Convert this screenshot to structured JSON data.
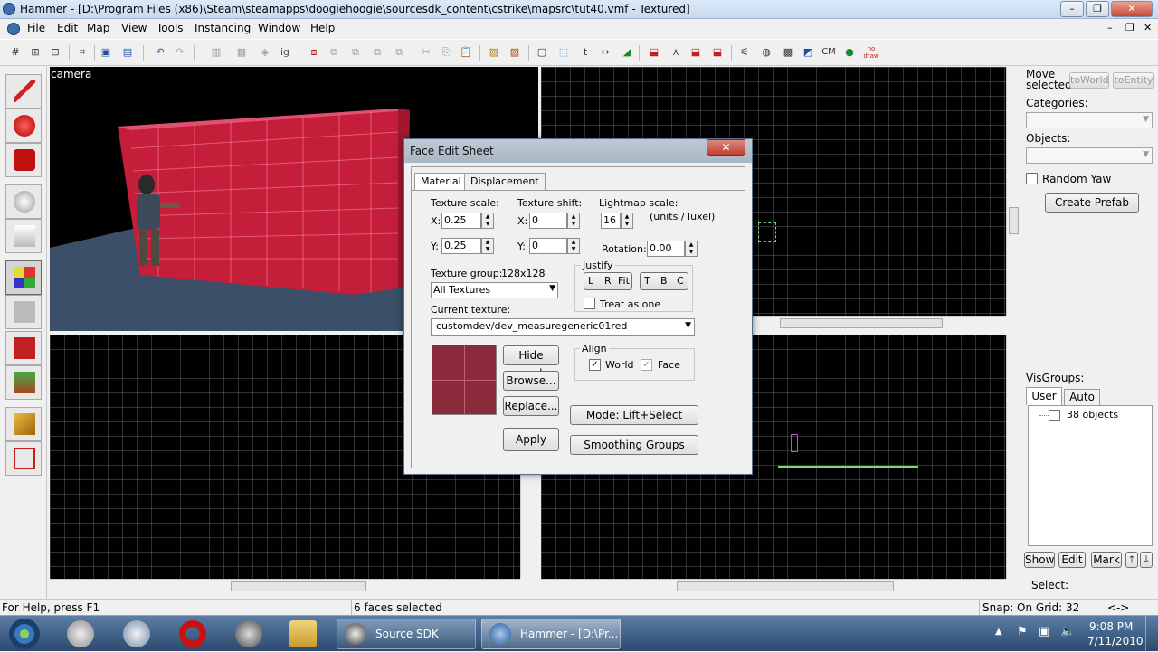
{
  "window": {
    "title": "Hammer - [D:\\Program Files (x86)\\Steam\\steamapps\\doogiehoogie\\sourcesdk_content\\cstrike\\mapsrc\\tut40.vmf - Textured]"
  },
  "menu": [
    "File",
    "Edit",
    "Map",
    "View",
    "Tools",
    "Instancing",
    "Window",
    "Help"
  ],
  "toolbar": {
    "cm_label": "CM",
    "nodraw_label": "no draw"
  },
  "viewports": {
    "camera_label": "camera"
  },
  "face_edit": {
    "title": "Face Edit Sheet",
    "close": "✕",
    "tabs": [
      "Material",
      "Displacement"
    ],
    "texture_scale_label": "Texture scale:",
    "texture_shift_label": "Texture shift:",
    "lightmap_scale_label": "Lightmap scale:",
    "units_label": "(units / luxel)",
    "x_label": "X:",
    "y_label": "Y:",
    "scale_x": "0.25",
    "scale_y": "0.25",
    "shift_x": "0",
    "shift_y": "0",
    "lightmap_scale": "16",
    "rotation_label": "Rotation:",
    "rotation": "0.00",
    "texture_group_label": "Texture group:",
    "texture_size": "128x128",
    "texture_group": "All Textures",
    "current_texture_label": "Current texture:",
    "current_texture": "customdev/dev_measuregeneric01red",
    "justify_label": "Justify",
    "justify_buttons": [
      "L",
      "R",
      "Fit",
      "T",
      "B",
      "C"
    ],
    "treat_as_one": "Treat as one",
    "hide_mask": "Hide mask",
    "browse": "Browse...",
    "replace": "Replace...",
    "apply": "Apply",
    "align_label": "Align",
    "align_world": "World",
    "align_face": "Face",
    "mode": "Mode: Lift+Select",
    "smoothing": "Smoothing Groups",
    "texture_color": "#8b2a3a"
  },
  "right_panel": {
    "move_selected_label": "Move selected:",
    "to_world": "toWorld",
    "to_entity": "toEntity",
    "categories_label": "Categories:",
    "objects_label": "Objects:",
    "random_yaw": "Random Yaw",
    "create_prefab": "Create Prefab",
    "visgroups_label": "VisGroups:",
    "vis_tabs": [
      "User",
      "Auto"
    ],
    "visgroup_item": "38 objects",
    "bottom_buttons": [
      "Show",
      "Edit",
      "Mark"
    ],
    "select_label": "Select:"
  },
  "status": {
    "help": "For Help, press F1",
    "selection": "6 faces selected",
    "snap": "Snap: On Grid: 32",
    "extra": "<->"
  },
  "taskbar": {
    "items": [
      "Source SDK",
      "Hammer - [D:\\Pr..."
    ],
    "time": "9:08 PM",
    "date": "7/11/2010"
  }
}
